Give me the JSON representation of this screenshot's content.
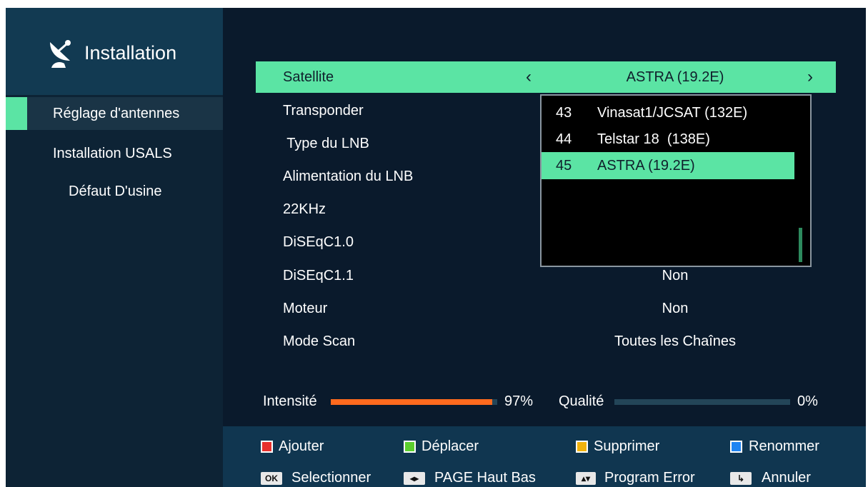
{
  "sidebar": {
    "title": "Installation",
    "items": [
      {
        "label": "Réglage d'antennes",
        "active": true
      },
      {
        "label": "Installation USALS"
      },
      {
        "label": "Défaut D'usine"
      }
    ]
  },
  "menu": {
    "rows": [
      {
        "label": "Satellite",
        "value": "ASTRA (19.2E)"
      },
      {
        "label": "Transponder",
        "value": ""
      },
      {
        "label": " Type du LNB",
        "value": ""
      },
      {
        "label": "Alimentation du LNB",
        "value": ""
      },
      {
        "label": "22KHz",
        "value": ""
      },
      {
        "label": "DiSEqC1.0",
        "value": ""
      },
      {
        "label": "DiSEqC1.1",
        "value": "Non"
      },
      {
        "label": "Moteur",
        "value": "Non"
      },
      {
        "label": "Mode Scan",
        "value": "Toutes les Chaînes"
      }
    ],
    "arrow_left": "‹",
    "arrow_right": "›"
  },
  "popup": {
    "items": [
      {
        "num": "43",
        "name": "Vinasat1/JCSAT (132E)"
      },
      {
        "num": "44",
        "name": "Telstar 18  (138E)"
      },
      {
        "num": "45",
        "name": "ASTRA (19.2E)",
        "selected": true
      }
    ]
  },
  "signal": {
    "intensity_label": "Intensité",
    "intensity_value": "97%",
    "intensity_level": 0.97,
    "quality_label": "Qualité",
    "quality_value": "0%",
    "quality_level": 0
  },
  "footer": {
    "red": "Ajouter",
    "green": "Déplacer",
    "yellow": "Supprimer",
    "blue": "Renommer",
    "ok_badge": "OK",
    "ok": "Selectionner",
    "page_badge": "◂▸",
    "page": "PAGE Haut Bas",
    "updown_badge": "▴▾",
    "updown": "Program Error",
    "back_badge": "↳",
    "back": "Annuler"
  },
  "colors": {
    "accent": "#5be4a4",
    "intensity_bar": "#ff6a1e",
    "red": "#e8302c",
    "green": "#5ccf2e",
    "yellow": "#f2b20c",
    "blue": "#1f84f2"
  }
}
